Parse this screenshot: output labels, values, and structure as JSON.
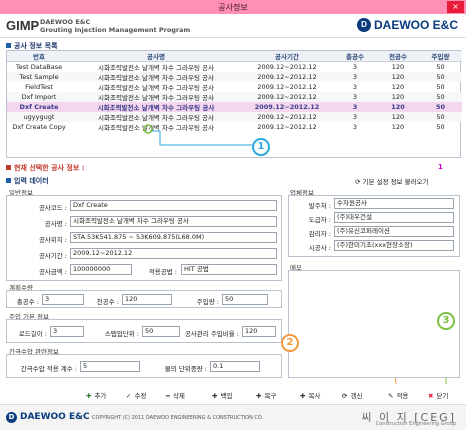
{
  "window": {
    "title": "공사정보",
    "close": "×"
  },
  "header": {
    "gimp": "GIMP",
    "sub_line1": "DAEWOO E&C",
    "sub_line2": "Grouting Injection Management Program",
    "brand": "DAEWOO E&C"
  },
  "list_section": {
    "title": "공사 정보 목록"
  },
  "grid": {
    "headers": [
      "번호",
      "공사명",
      "공사기간",
      "총공수",
      "천공수",
      "주입량"
    ],
    "rows": [
      [
        "Test DataBase",
        "시화조력발전소 날개벽 차수 그라우팅 공사",
        "2009.12~2012.12",
        "3",
        "120",
        "50"
      ],
      [
        "Test Sample",
        "시화조력발전소 날개벽 차수 그라우팅 공사",
        "2009.12~2012.12",
        "3",
        "120",
        "50"
      ],
      [
        "FieldTest",
        "시화조력발전소 날개벽 차수 그라우팅 공사",
        "2009.12~2012.12",
        "3",
        "120",
        "50"
      ],
      [
        "Dxf Import",
        "시화조력발전소 날개벽 차수 그라우팅 공사",
        "2009.12~2012.12",
        "3",
        "120",
        "50"
      ],
      [
        "Dxf Create",
        "시화조력발전소 날개벽 차수 그라우팅 공사",
        "2009.12~2012.12",
        "3",
        "120",
        "50"
      ],
      [
        "ugyygugt",
        "시화조력발전소 날개벽 차수 그라우팅 공사",
        "2009.12~2012.12",
        "3",
        "120",
        "50"
      ],
      [
        "Dxf Create Copy",
        "시화조력발전소 날개벽 차수 그라우팅 공사",
        "2009.12~2012.12",
        "3",
        "120",
        "50"
      ]
    ],
    "selected_index": 4
  },
  "selection": {
    "label": "현재 선택한 공사 정보 :",
    "count": "1"
  },
  "input_section": {
    "title": "입력 데이터",
    "reload": "기본 설정 정보 불러오기"
  },
  "general": {
    "title": "일반정보",
    "code_label": "공사코드 :",
    "code": "Dxf Create",
    "name_label": "공사명 :",
    "name": "시화조력발전소 날개벽 차수 그라우팅 공사",
    "loc_label": "공사위치 :",
    "loc": "STA.53K541.875 ~ 53K609.875(L68.0M)",
    "period_label": "공사기간 :",
    "period": "2009.12~2012.12",
    "amount_label": "공사금액 :",
    "amount": "100000000",
    "method_label": "적용공법 :",
    "method": "HIT 공법"
  },
  "plan": {
    "title": "계획수량",
    "total_label": "총공수 :",
    "total": "3",
    "drill_label": "천공수 :",
    "drill": "120",
    "inject_label": "주입량 :",
    "inject": "50"
  },
  "basic": {
    "title": "주입 기본 정보",
    "rod_label": "로드길이 :",
    "rod": "3",
    "step_label": "스텝업단위 :",
    "step": "50",
    "ratio_label": "공사관리 주입비율 :",
    "ratio": "120"
  },
  "interval": {
    "title": "간극수압 관련정보",
    "coef_label": "간극수압 적용 계수 :",
    "coef": "5",
    "weight_label": "물의 단위중량 :",
    "weight": "0.1"
  },
  "company": {
    "title": "업체정보",
    "owner_label": "발주처 :",
    "owner": "수자원공사",
    "contractor_label": "도급자 :",
    "contractor": "(주)대우건설",
    "supervisor_label": "감리자 :",
    "supervisor": "(주)유신코퍼레이션",
    "builder_label": "시공사 :",
    "builder": "(주)한미기초(xxx현장소장)"
  },
  "memo": {
    "title": "메모"
  },
  "toolbar": {
    "add": "추가",
    "edit": "수정",
    "delete": "삭제",
    "backup": "백업",
    "restore": "복구",
    "copy": "복사",
    "refresh": "갱신",
    "apply": "적용",
    "close": "닫기"
  },
  "callouts": {
    "one": "1",
    "two": "2",
    "three": "3"
  },
  "footer": {
    "logo": "DAEWOO E&C",
    "copyright": "COPYRIGHT (C) 2011 DAEWOO ENGINEERING & CONSTRUCTION CO.",
    "ceg": "씨 이 지 [CEG]",
    "ceg_sub": "Construction Engineering Group"
  },
  "colors": {
    "titlebar": "#ff8fb4",
    "selected_row": "#f5d6ef",
    "accent": "#1f5fa8",
    "callout1": "#29a8e0",
    "callout2": "#f39a3c",
    "callout3": "#7cc242"
  }
}
